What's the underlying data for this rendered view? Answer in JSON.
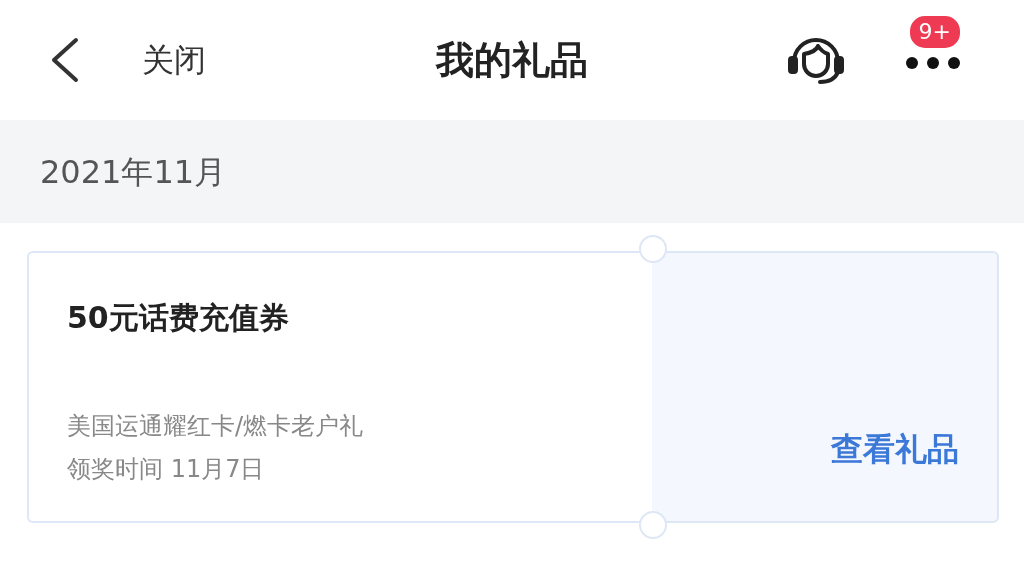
{
  "header": {
    "close_label": "关闭",
    "title": "我的礼品",
    "badge": "9+"
  },
  "month": "2021年11月",
  "gifts": [
    {
      "title": "50元话费充值券",
      "source": "美国运通耀红卡/燃卡老户礼",
      "claim_time": "领奖时间 11月7日",
      "action": "查看礼品"
    }
  ]
}
